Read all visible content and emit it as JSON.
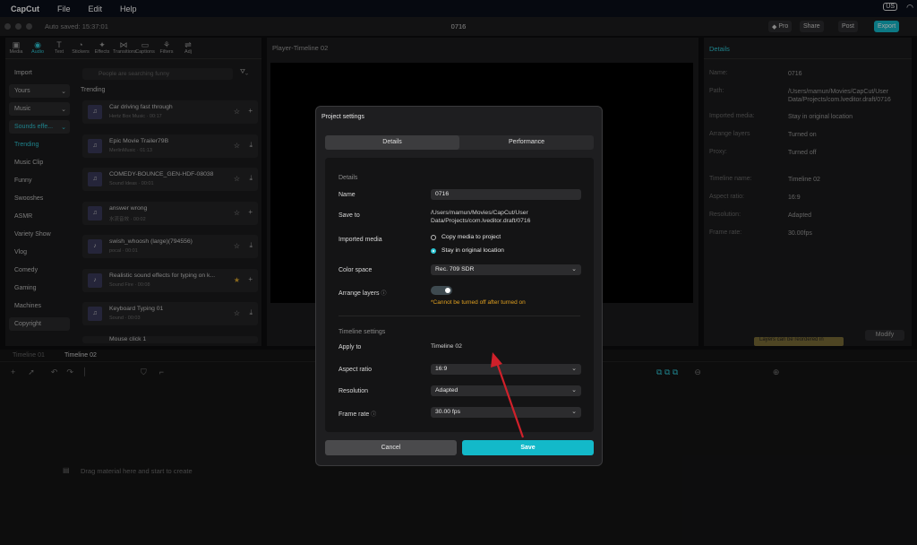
{
  "menubar": {
    "app": "CapCut",
    "items": [
      "File",
      "Edit",
      "Help"
    ],
    "keyboard": "US"
  },
  "titlebar": {
    "autosave": "Auto saved: 15:37:01",
    "project": "0716",
    "pro": "Pro",
    "share": "Share",
    "post": "Post",
    "export": "Export"
  },
  "toolbar": {
    "tabs": [
      "Media",
      "Audio",
      "Text",
      "Stickers",
      "Effects",
      "Transitions",
      "Captions",
      "Filters",
      "Adj"
    ]
  },
  "library": {
    "categories": [
      "Import",
      "Yours",
      "Music",
      "Sounds effe...",
      "Trending",
      "Music Clip",
      "Funny",
      "Swooshes",
      "ASMR",
      "Variety Show",
      "Vlog",
      "Comedy",
      "Gaming",
      "Machines",
      "Copyright"
    ],
    "search_placeholder": "People are searching funny",
    "section": "Trending",
    "items": [
      {
        "title": "Car driving fast through",
        "sub": "Hertz Box Music · 00:17"
      },
      {
        "title": "Epic Movie Trailer79B",
        "sub": "MerlinMusic · 01:13"
      },
      {
        "title": "COMEDY-BOUNCE_GEN-HDF-08038",
        "sub": "Sound Ideas · 00:01"
      },
      {
        "title": "answer wrong",
        "sub": "水流音效 · 00:02"
      },
      {
        "title": "swish_whoosh (large)(794556)",
        "sub": "pocal · 00:01"
      },
      {
        "title": "Realistic sound effects for typing on k...",
        "sub": "Sound Fire · 00:08"
      },
      {
        "title": "Keyboard Typing 01",
        "sub": "Sound · 00:03"
      },
      {
        "title": "Mouse click 1",
        "sub": ""
      }
    ]
  },
  "player": {
    "label": "Player-Timeline 02"
  },
  "details_panel": {
    "header": "Details",
    "rows": [
      {
        "k": "Name:",
        "v": "0716"
      },
      {
        "k": "Path:",
        "v": "/Users/mamun/Movies/CapCut/User Data/Projects/com.lveditor.draft/0716"
      },
      {
        "k": "Imported media:",
        "v": "Stay in original location"
      },
      {
        "k": "Arrange layers",
        "v": "Turned on"
      },
      {
        "k": "Proxy:",
        "v": "Turned off"
      },
      {
        "k": "Timeline name:",
        "v": "Timeline 02"
      },
      {
        "k": "Aspect ratio:",
        "v": "16:9"
      },
      {
        "k": "Resolution:",
        "v": "Adapted"
      },
      {
        "k": "Frame rate:",
        "v": "30.00fps"
      }
    ],
    "modify": "Modify",
    "tooltip": "Layers can be reordered in"
  },
  "timeline": {
    "tab1": "Timeline 01",
    "tab2": "Timeline 02",
    "empty": "Drag material here and start to create"
  },
  "dialog": {
    "title": "Project settings",
    "tab_details": "Details",
    "tab_performance": "Performance",
    "section_details": "Details",
    "name_label": "Name",
    "name_value": "0716",
    "saveto_label": "Save to",
    "saveto_value": "/Users/mamun/Movies/CapCut/User Data/Projects/com.lveditor.draft/0716",
    "imported_label": "Imported media",
    "opt_copy": "Copy media to project",
    "opt_stay": "Stay in original location",
    "colorspace_label": "Color space",
    "colorspace_value": "Rec. 709 SDR",
    "arrange_label": "Arrange layers",
    "arrange_warning": "*Cannot be turned off after turned on",
    "section_timeline": "Timeline settings",
    "applyto_label": "Apply to",
    "applyto_value": "Timeline 02",
    "aspect_label": "Aspect ratio",
    "aspect_value": "16:9",
    "resolution_label": "Resolution",
    "resolution_value": "Adapted",
    "framerate_label": "Frame rate",
    "framerate_value": "30.00 fps",
    "cancel": "Cancel",
    "save": "Save"
  },
  "colors": {
    "accent": "#13b9c9",
    "warning": "#e0a020",
    "arrow": "#d0202a"
  }
}
